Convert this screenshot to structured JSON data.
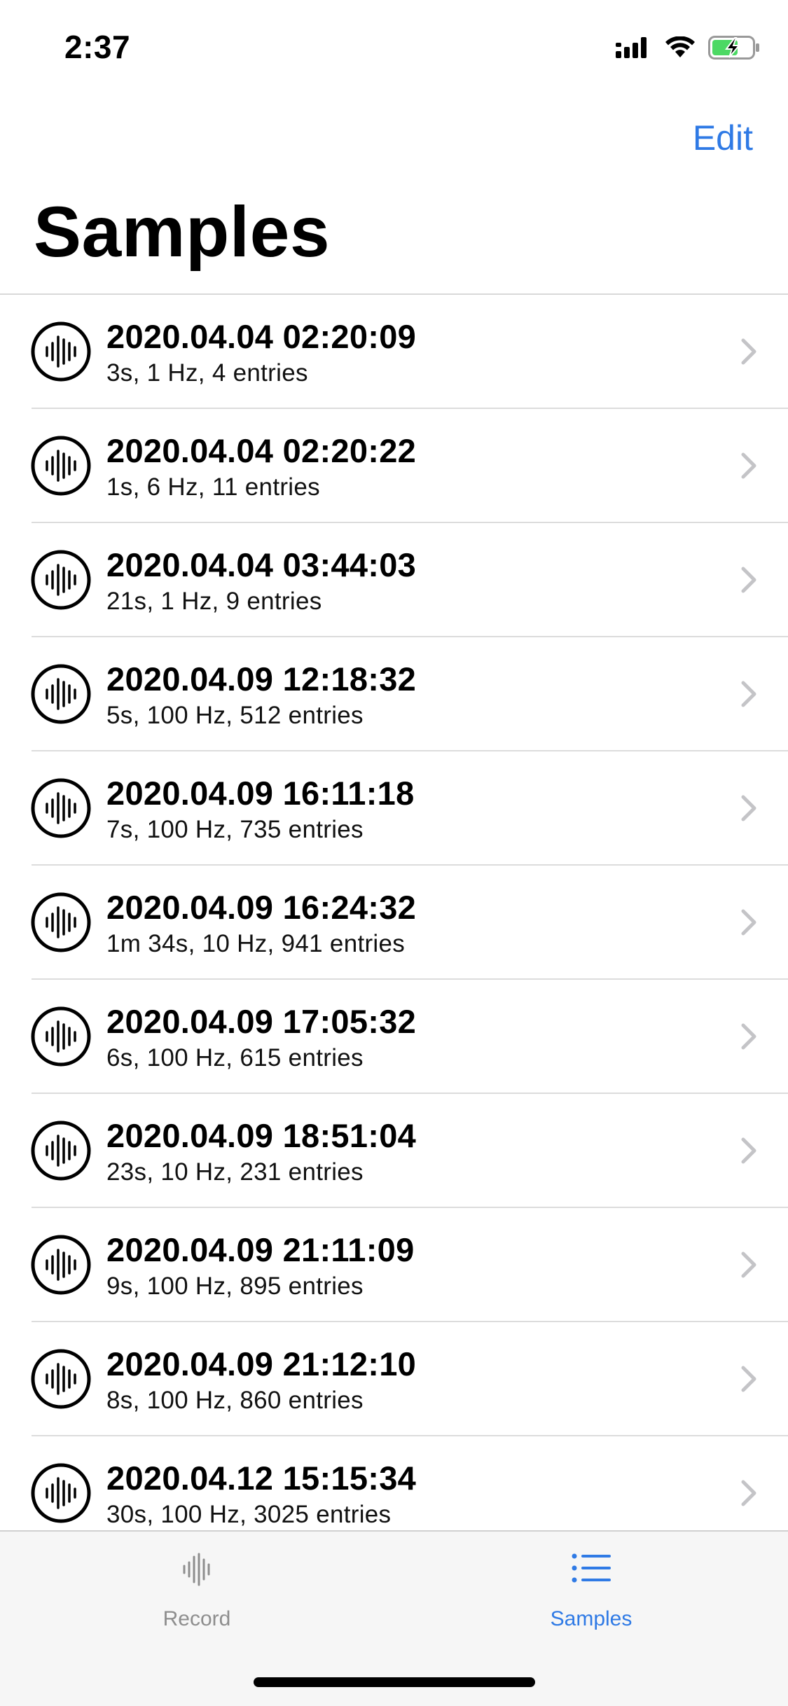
{
  "status_bar": {
    "time": "2:37",
    "icons": [
      "cellular-signal-icon",
      "wifi-icon",
      "battery-charging-icon"
    ],
    "battery_color": "#4cd964"
  },
  "nav": {
    "edit_label": "Edit",
    "title": "Samples"
  },
  "samples": [
    {
      "title": "2020.04.04 02:20:09",
      "subtitle": "3s, 1 Hz, 4 entries"
    },
    {
      "title": "2020.04.04 02:20:22",
      "subtitle": "1s, 6 Hz, 11 entries"
    },
    {
      "title": "2020.04.04 03:44:03",
      "subtitle": "21s, 1 Hz, 9 entries"
    },
    {
      "title": "2020.04.09 12:18:32",
      "subtitle": "5s, 100 Hz, 512 entries"
    },
    {
      "title": "2020.04.09 16:11:18",
      "subtitle": "7s, 100 Hz, 735 entries"
    },
    {
      "title": "2020.04.09 16:24:32",
      "subtitle": "1m 34s, 10 Hz, 941 entries"
    },
    {
      "title": "2020.04.09 17:05:32",
      "subtitle": "6s, 100 Hz, 615 entries"
    },
    {
      "title": "2020.04.09 18:51:04",
      "subtitle": "23s, 10 Hz, 231 entries"
    },
    {
      "title": "2020.04.09 21:11:09",
      "subtitle": "9s, 100 Hz, 895 entries"
    },
    {
      "title": "2020.04.09 21:12:10",
      "subtitle": "8s, 100 Hz, 860 entries"
    },
    {
      "title": "2020.04.12 15:15:34",
      "subtitle": "30s, 100 Hz, 3025 entries"
    }
  ],
  "tab_bar": {
    "tabs": [
      {
        "label": "Record",
        "icon": "waveform-icon",
        "selected": false
      },
      {
        "label": "Samples",
        "icon": "list-icon",
        "selected": true
      }
    ]
  },
  "colors": {
    "accent": "#2f7ae5",
    "inactive_tab": "#8e8e8e",
    "tab_bar_bg": "#f6f6f6"
  }
}
